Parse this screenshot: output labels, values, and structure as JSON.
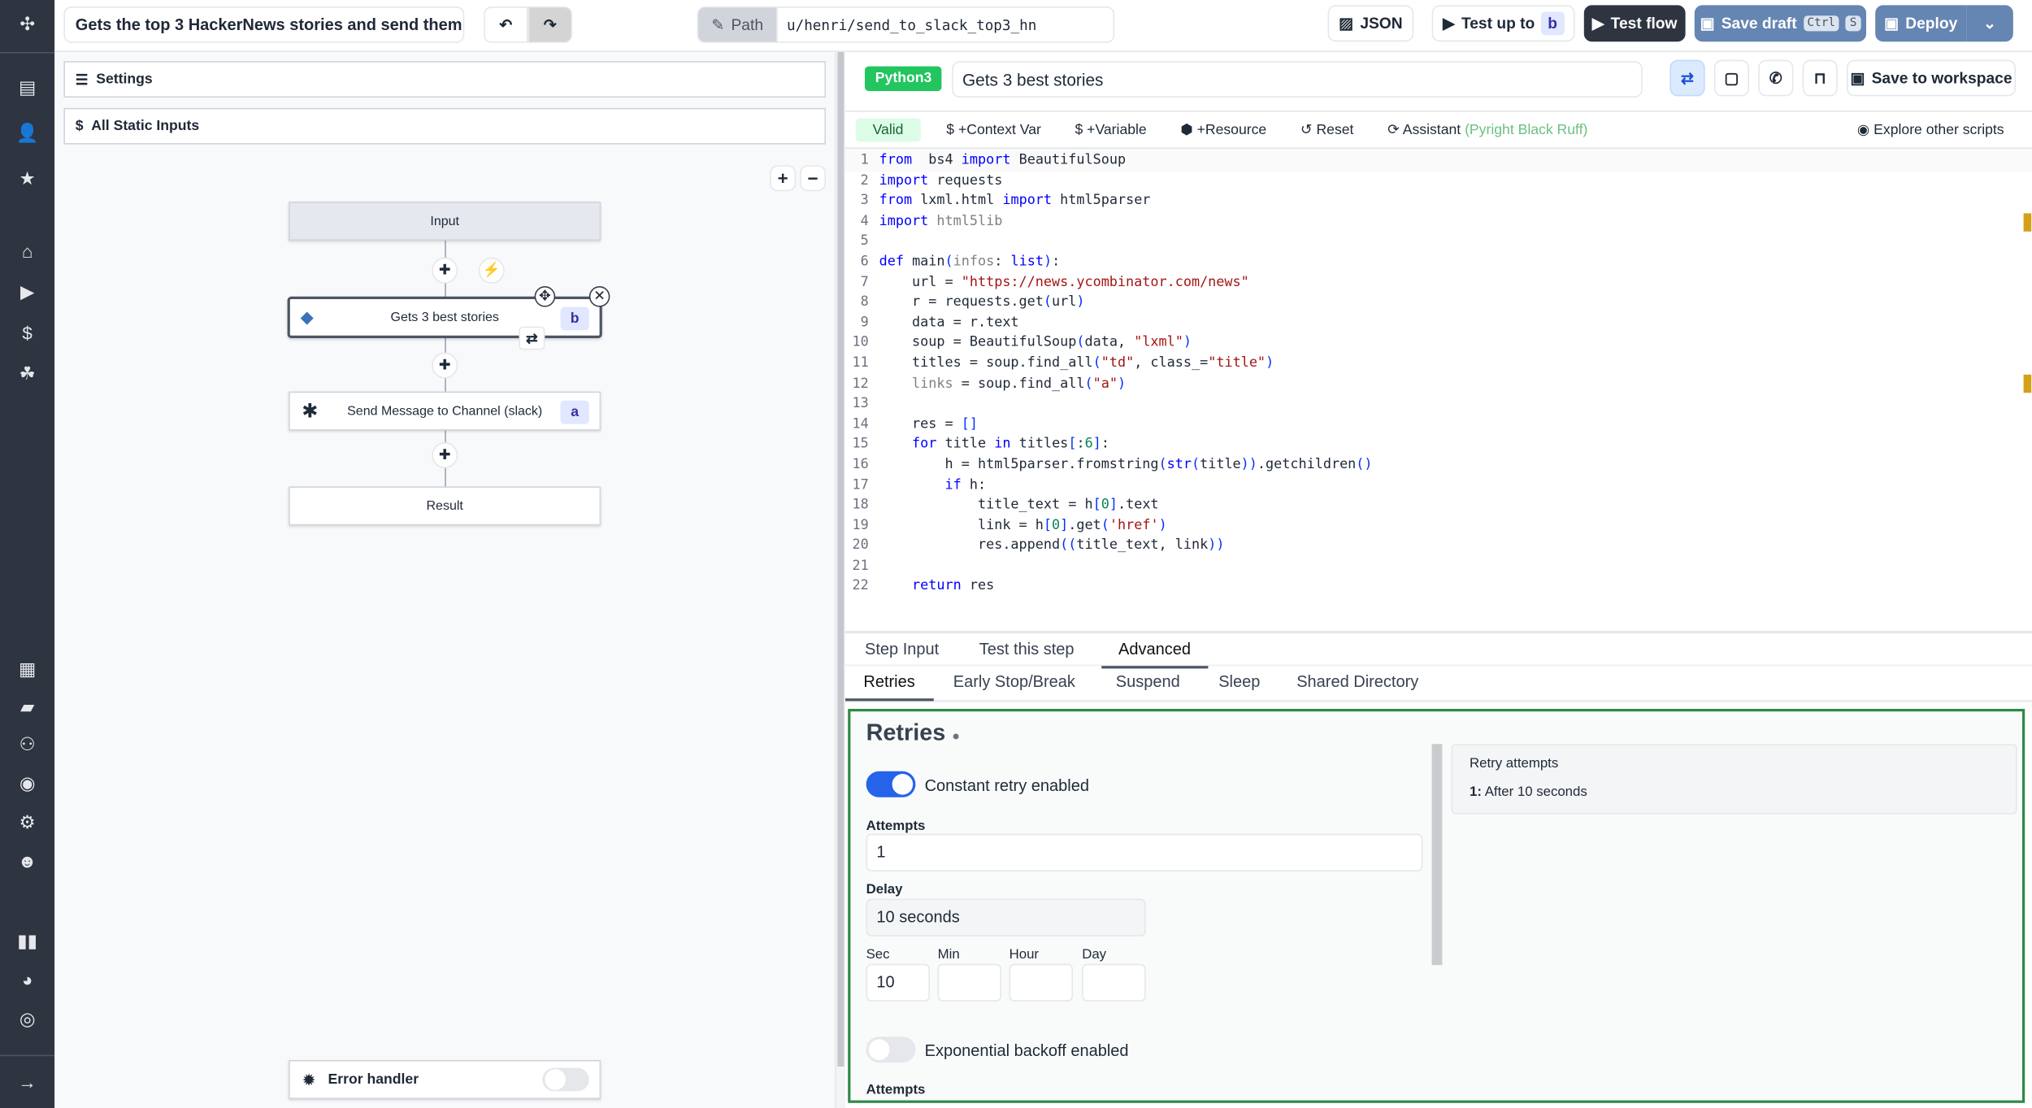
{
  "sidebar": {
    "icons": [
      [
        "windmill-logo-icon",
        "✣",
        18
      ],
      [
        "script-icon",
        "▤",
        67
      ],
      [
        "user-icon",
        "👤",
        102
      ],
      [
        "star-icon",
        "★",
        137
      ],
      [
        "home-icon",
        "⌂",
        193
      ],
      [
        "play-icon",
        "▶",
        224
      ],
      [
        "dollar-icon",
        "$",
        256
      ],
      [
        "resources-icon",
        "☘",
        287
      ],
      [
        "calendar-icon",
        "▦",
        514
      ],
      [
        "folder-icon",
        "▰",
        543
      ],
      [
        "groups-icon",
        "⚇",
        572
      ],
      [
        "eye-icon",
        "◉",
        602
      ],
      [
        "settings-icon",
        "⚙",
        632
      ],
      [
        "bot-icon",
        "☻",
        662
      ],
      [
        "docs-icon",
        "▮▮",
        723
      ],
      [
        "discord-icon",
        "◕",
        753
      ],
      [
        "github-icon",
        "◎",
        783
      ],
      [
        "expand-icon",
        "→",
        832
      ]
    ]
  },
  "topbar": {
    "flow_title": "Gets the top 3 HackerNews stories and send them",
    "path_label": "Path",
    "path_value": "u/henri/send_to_slack_top3_hn",
    "json": "JSON",
    "test_up_to": "Test up to",
    "test_up_to_step": "b",
    "test_flow": "Test flow",
    "save_draft": "Save draft",
    "kbd_ctrl": "Ctrl",
    "kbd_s": "S",
    "deploy": "Deploy"
  },
  "left": {
    "settings": "Settings",
    "static_inputs": "All Static Inputs",
    "nodes": {
      "input": "Input",
      "step_b": "Gets 3 best stories",
      "step_b_id": "b",
      "step_a": "Send Message to Channel (slack)",
      "step_a_id": "a",
      "result": "Result"
    },
    "error_handler": "Error handler"
  },
  "editor": {
    "language": "Python3",
    "summary": "Gets 3 best stories",
    "save_to_workspace": "Save to workspace",
    "valid": "Valid",
    "context_var": "+Context Var",
    "variable": "+Variable",
    "resource": "+Resource",
    "reset": "Reset",
    "assistant": "Assistant",
    "assistant_tools": "(Pyright Black Ruff)",
    "explore": "Explore other scripts",
    "code": [
      [
        [
          "kw",
          "from"
        ],
        [
          "",
          "  bs4 "
        ],
        [
          "kw",
          "import"
        ],
        [
          "",
          " BeautifulSoup"
        ]
      ],
      [
        [
          "kw",
          "import"
        ],
        [
          "",
          " requests"
        ]
      ],
      [
        [
          "kw",
          "from"
        ],
        [
          "",
          " lxml.html "
        ],
        [
          "kw",
          "import"
        ],
        [
          "",
          " html5parser"
        ]
      ],
      [
        [
          "kw",
          "import"
        ],
        [
          "",
          " "
        ],
        [
          "dim",
          "html5lib"
        ]
      ],
      [],
      [
        [
          "kw",
          "def"
        ],
        [
          "",
          " main"
        ],
        [
          "par",
          "("
        ],
        [
          "dim",
          "infos"
        ],
        [
          "",
          ": "
        ],
        [
          "kw",
          "list"
        ],
        [
          "par",
          ")"
        ],
        [
          "",
          ":"
        ]
      ],
      [
        [
          "",
          "    url = "
        ],
        [
          "str",
          "\"https://news.ycombinator.com/news\""
        ]
      ],
      [
        [
          "",
          "    r = requests.get"
        ],
        [
          "par",
          "("
        ],
        [
          "",
          "url"
        ],
        [
          "par",
          ")"
        ]
      ],
      [
        [
          "",
          "    data = r.text"
        ]
      ],
      [
        [
          "",
          "    soup = BeautifulSoup"
        ],
        [
          "par",
          "("
        ],
        [
          "",
          "data, "
        ],
        [
          "str",
          "\"lxml\""
        ],
        [
          "par",
          ")"
        ]
      ],
      [
        [
          "",
          "    titles = soup.find_all"
        ],
        [
          "par",
          "("
        ],
        [
          "str",
          "\"td\""
        ],
        [
          "",
          ", class_="
        ],
        [
          "str",
          "\"title\""
        ],
        [
          "par",
          ")"
        ]
      ],
      [
        [
          "dim",
          "    links"
        ],
        [
          "",
          " = soup.find_all"
        ],
        [
          "par",
          "("
        ],
        [
          "str",
          "\"a\""
        ],
        [
          "par",
          ")"
        ]
      ],
      [],
      [
        [
          "",
          "    res = "
        ],
        [
          "par",
          "[]"
        ]
      ],
      [
        [
          "kw",
          "    for"
        ],
        [
          "",
          " title "
        ],
        [
          "kw",
          "in"
        ],
        [
          "",
          " titles"
        ],
        [
          "par",
          "["
        ],
        [
          "",
          ":"
        ],
        [
          "num",
          "6"
        ],
        [
          "par",
          "]"
        ],
        [
          "",
          ":"
        ]
      ],
      [
        [
          "",
          "        h = html5parser.fromstring"
        ],
        [
          "par",
          "("
        ],
        [
          "kw",
          "str"
        ],
        [
          "par",
          "("
        ],
        [
          "",
          "title"
        ],
        [
          "par",
          "))"
        ],
        [
          "",
          ".getchildren"
        ],
        [
          "par",
          "()"
        ]
      ],
      [
        [
          "kw",
          "        if"
        ],
        [
          "",
          " h:"
        ]
      ],
      [
        [
          "",
          "            title_text = h"
        ],
        [
          "par",
          "["
        ],
        [
          "num",
          "0"
        ],
        [
          "par",
          "]"
        ],
        [
          "",
          ".text"
        ]
      ],
      [
        [
          "",
          "            link = h"
        ],
        [
          "par",
          "["
        ],
        [
          "num",
          "0"
        ],
        [
          "par",
          "]"
        ],
        [
          "",
          ".get"
        ],
        [
          "par",
          "("
        ],
        [
          "str",
          "'href'"
        ],
        [
          "par",
          ")"
        ]
      ],
      [
        [
          "",
          "            res.append"
        ],
        [
          "par",
          "(("
        ],
        [
          "",
          "title_text, link"
        ],
        [
          "par",
          "))"
        ]
      ],
      [],
      [
        [
          "kw",
          "    return"
        ],
        [
          "",
          " res"
        ]
      ]
    ]
  },
  "tabs": {
    "step_input": "Step Input",
    "test_step": "Test this step",
    "advanced": "Advanced"
  },
  "subtabs": {
    "retries": "Retries",
    "early_stop": "Early Stop/Break",
    "suspend": "Suspend",
    "sleep": "Sleep",
    "shared_dir": "Shared Directory"
  },
  "retries": {
    "title": "Retries",
    "constant": "Constant retry enabled",
    "constant_on": true,
    "attempts_label": "Attempts",
    "attempts": "1",
    "delay_label": "Delay",
    "delay": "10 seconds",
    "sec": "Sec",
    "min": "Min",
    "hour": "Hour",
    "day": "Day",
    "sec_value": "10",
    "exponential": "Exponential backoff enabled",
    "exponential_on": false,
    "attempts2_label": "Attempts",
    "summary_title": "Retry attempts",
    "summary_index": "1:",
    "summary_item": "After 10 seconds"
  },
  "colors": {
    "accent_green": "#2f8a47",
    "toggle_blue": "#2563eb",
    "deploy": "#6585b2",
    "dark": "#2e3440"
  }
}
